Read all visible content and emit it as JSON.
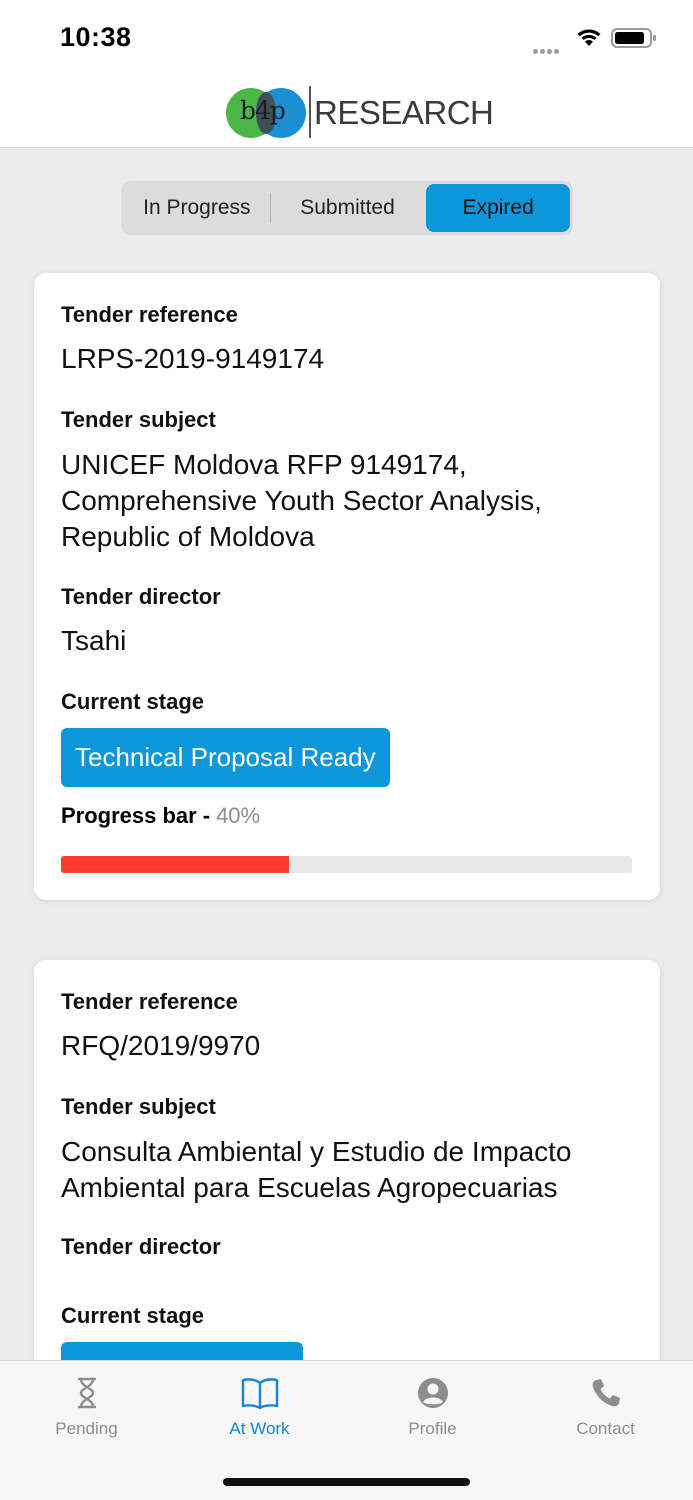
{
  "status_bar": {
    "time": "10:38"
  },
  "brand": {
    "logo_mark": "b4p",
    "logo_text": "RESEARCH"
  },
  "segments": {
    "in_progress": "In Progress",
    "submitted": "Submitted",
    "expired": "Expired",
    "selected": "Expired"
  },
  "tenders": [
    {
      "reference_label": "Tender reference",
      "reference": "LRPS-2019-9149174",
      "subject_label": "Tender subject",
      "subject": "UNICEF Moldova RFP 9149174, Comprehensive Youth Sector Analysis, Republic of Moldova",
      "director_label": "Tender director",
      "director": "Tsahi",
      "stage_label": "Current stage",
      "stage": "Technical Proposal Ready",
      "progress_label": "Progress bar",
      "progress_separator": "-",
      "progress_text": "40%",
      "progress": 0.4
    },
    {
      "reference_label": "Tender reference",
      "reference": "RFQ/2019/9970",
      "subject_label": "Tender subject",
      "subject": "Consulta Ambiental y Estudio de Impacto Ambiental para Escuelas Agropecuarias",
      "director_label": "Tender director",
      "director": "",
      "stage_label": "Current stage"
    }
  ],
  "tabs": [
    {
      "label": "Pending",
      "icon": "hourglass-icon"
    },
    {
      "label": "At Work",
      "icon": "book-icon",
      "active": true
    },
    {
      "label": "Profile",
      "icon": "profile-icon"
    },
    {
      "label": "Contact",
      "icon": "phone-icon"
    }
  ],
  "colors": {
    "accent": "#0d96da",
    "progress": "#ff3b30",
    "tab_active": "#1484d3"
  }
}
